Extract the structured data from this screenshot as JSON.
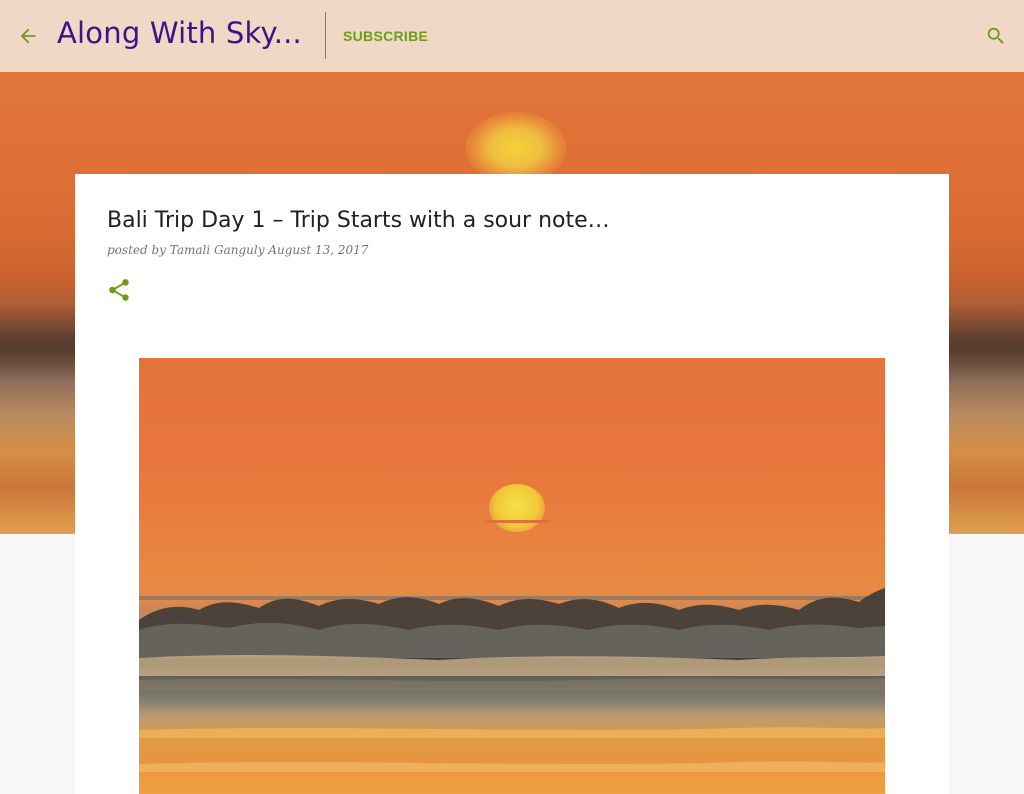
{
  "header": {
    "blog_title": "Along With Sky...",
    "subscribe_label": "SUBSCRIBE",
    "back_icon": "arrow-left-icon",
    "search_icon": "search-icon"
  },
  "post": {
    "title": "Bali Trip Day 1 – Trip Starts with a sour note…",
    "posted_by_prefix": "posted by",
    "author": "Tamali Ganguly",
    "date": "August 13, 2017",
    "share_icon": "share-icon"
  },
  "colors": {
    "header_background": "#efd8c5",
    "blog_title": "#3b148c",
    "accent_green": "#6e9c1a"
  }
}
